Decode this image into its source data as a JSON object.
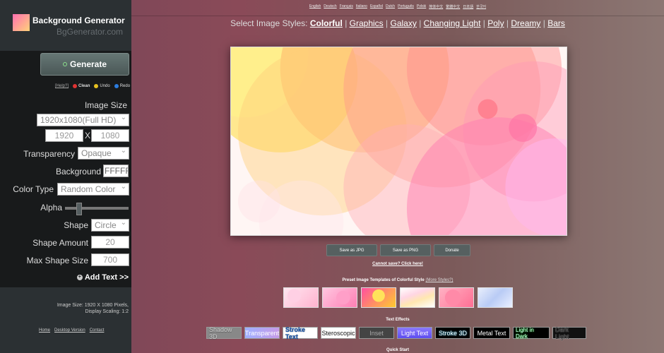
{
  "brand": {
    "title": "Background Generator",
    "subtitle": "BgGenerator.com"
  },
  "generate_label": "Generate",
  "actions": {
    "help": "[Help?]",
    "clean": "Clean",
    "undo": "Undo",
    "redo": "Redo"
  },
  "settings": {
    "image_size_label": "Image Size",
    "image_size_value": "1920x1080(Full HD)",
    "width": "1920",
    "height": "1080",
    "x_label": "X",
    "transparency_label": "Transparency",
    "transparency_value": "Opaque",
    "background_label": "Background",
    "background_value": "FFFFFF",
    "color_type_label": "Color Type",
    "color_type_value": "Random Color",
    "alpha_label": "Alpha",
    "alpha_value": 0.2,
    "shape_label": "Shape",
    "shape_value": "Circle",
    "shape_amount_label": "Shape Amount",
    "shape_amount_value": "20",
    "max_shape_size_label": "Max Shape Size",
    "max_shape_size_value": "700"
  },
  "add_text_label": "Add Text >>",
  "info": {
    "line1": "Image Size: 1920 X 1080 Pixels,",
    "line2": "Display Scaling: 1:2"
  },
  "footer_links": [
    "Home",
    "Desktop Version",
    "Contact"
  ],
  "languages": [
    "English",
    "Deutsch",
    "Français",
    "Italiano",
    "Español",
    "Dutch",
    "Português",
    "Polski",
    "简体中文",
    "繁體中文",
    "日本語",
    "한국어"
  ],
  "styles": {
    "prefix": "Select Image Styles:",
    "items": [
      "Colorful",
      "Graphics",
      "Galaxy",
      "Changing Light",
      "Poly",
      "Dreamy",
      "Bars"
    ],
    "separator": "|"
  },
  "buttons": {
    "save_jpg": "Save as JPG",
    "save_png": "Save as PNG",
    "donate": "Donate"
  },
  "cannot_save": "Cannot save? Click here!",
  "presets": {
    "title": "Preset Image Templates of Colorful Style",
    "more": "(More Styles?)"
  },
  "effects_title": "Text Effects",
  "effects": [
    "Shadow 3D",
    "Transparent",
    "Stroke Text",
    "Steroscopic",
    "Inset",
    "Light Text",
    "Stroke 3D",
    "Metal Text",
    "Light in Dark",
    "Dark Light"
  ],
  "quick_start": "Quick Start",
  "colors": {
    "sidebar_bg": "#181a1b",
    "header_bg": "#2b3033",
    "button_bg": "#566060"
  }
}
